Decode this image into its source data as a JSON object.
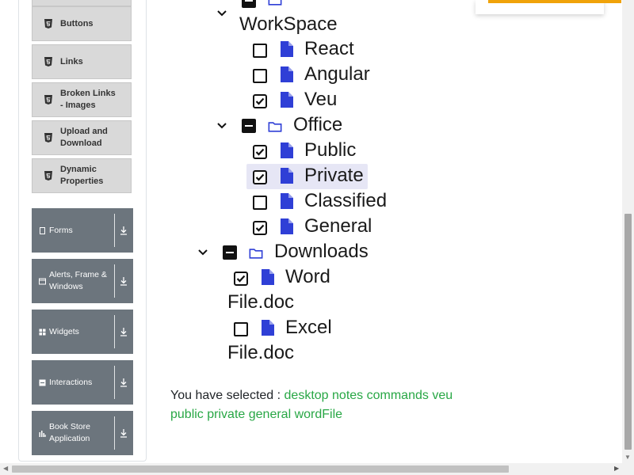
{
  "sidebar": {
    "sub_items": [
      {
        "label": "Buttons",
        "icon": "html5-icon"
      },
      {
        "label": "Links",
        "icon": "html5-icon"
      },
      {
        "label": "Broken Links - Images",
        "icon": "html5-icon"
      },
      {
        "label": "Upload and Download",
        "icon": "html5-icon"
      },
      {
        "label": "Dynamic Properties",
        "icon": "html5-icon"
      }
    ],
    "groups": [
      {
        "label": "Forms",
        "icon": "file-icon"
      },
      {
        "label": "Alerts, Frame & Windows",
        "icon": "window-icon"
      },
      {
        "label": "Widgets",
        "icon": "grid-icon"
      },
      {
        "label": "Interactions",
        "icon": "list-icon"
      },
      {
        "label": "Book Store Application",
        "icon": "chart-icon"
      }
    ]
  },
  "tree": {
    "workspace_label": "WorkSpace",
    "react_label": "React",
    "angular_label": "Angular",
    "veu_label": "Veu",
    "office_label": "Office",
    "public_label": "Public",
    "private_label": "Private",
    "classified_label": "Classified",
    "general_label": "General",
    "downloads_label": "Downloads",
    "word_label_1": "Word",
    "word_label_2": "File.doc",
    "excel_label_1": "Excel",
    "excel_label_2": "File.doc"
  },
  "result": {
    "prefix": "You have selected : ",
    "items": [
      "desktop",
      "notes",
      "commands",
      "veu",
      "public",
      "private",
      "general",
      "wordFile"
    ]
  },
  "colors": {
    "accent_blue": "#2f3fd6",
    "selected_green": "#28a745",
    "sidebar_group": "#6c757d",
    "popup_accent": "#f0a30a"
  }
}
